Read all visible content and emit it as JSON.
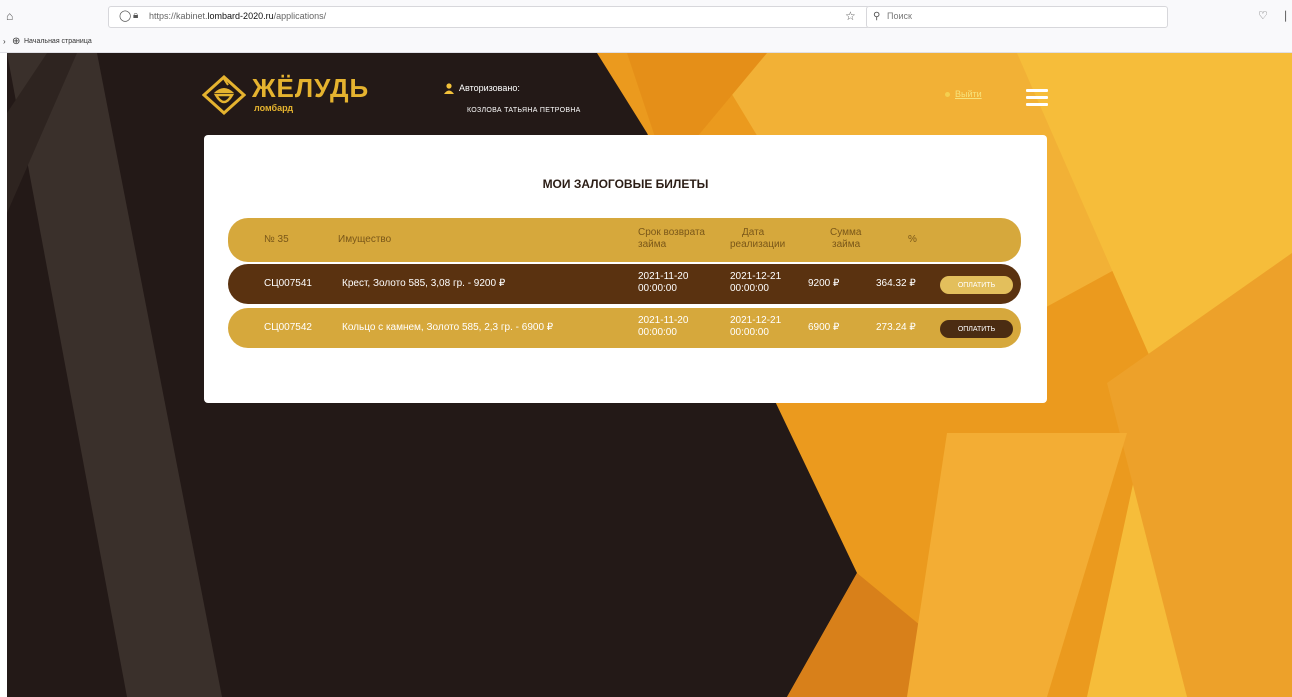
{
  "browser": {
    "url_prefix": "https://kabinet.",
    "url_host": "lombard-2020.ru",
    "url_path": "/applications/",
    "search_placeholder": "Поиск",
    "bookmark_label": "Начальная страница"
  },
  "colors": {
    "dark_bg": "#231917",
    "orange": "#eb9a1e",
    "gold": "#d6a83c",
    "brown": "#5a3210"
  },
  "header": {
    "brand_name": "ЖЁЛУДЬ",
    "brand_sub": "ломбард",
    "auth_label": "Авторизовано:",
    "user_name": "КОЗЛОВА ТАТЬЯНА ПЕТРОВНА",
    "logout": "Выйти",
    "menu_icon": "hamburger-icon"
  },
  "main": {
    "title": "МОИ ЗАЛОГОВЫЕ БИЛЕТЫ",
    "columns": {
      "number": "№ 35",
      "property": "Имущество",
      "return_1": "Срок возврата",
      "return_2": "займа",
      "sale_1": "Дата",
      "sale_2": "реализации",
      "sum_1": "Сумма",
      "sum_2": "займа",
      "percent": "%"
    },
    "tickets": [
      {
        "id": "СЦ007541",
        "property": "Крест, Золото 585, 3,08 гр. - 9200 ₽",
        "return_date": "2021-11-20",
        "return_time": "00:00:00",
        "sale_date": "2021-12-21",
        "sale_time": "00:00:00",
        "sum": "9200 ₽",
        "percent": "364.32 ₽",
        "pay": "ОПЛАТИТЬ"
      },
      {
        "id": "СЦ007542",
        "property": "Кольцо с камнем, Золото 585, 2,3 гр. - 6900 ₽",
        "return_date": "2021-11-20",
        "return_time": "00:00:00",
        "sale_date": "2021-12-21",
        "sale_time": "00:00:00",
        "sum": "6900 ₽",
        "percent": "273.24 ₽",
        "pay": "ОПЛАТИТЬ"
      }
    ]
  }
}
